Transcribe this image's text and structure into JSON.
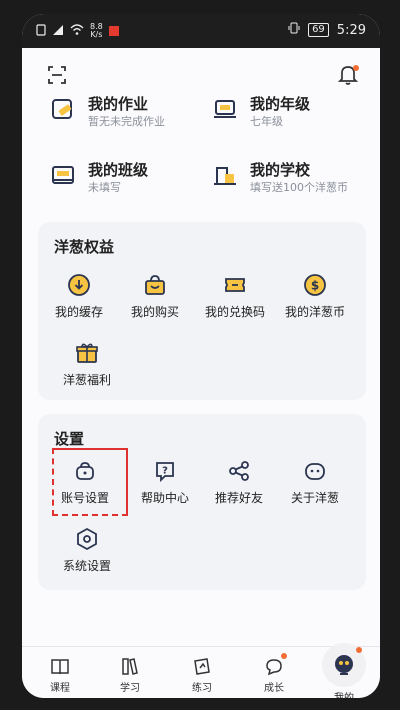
{
  "status_bar": {
    "net_speed_top": "8.8",
    "net_speed_unit": "K/s",
    "battery": "69",
    "time": "5:29"
  },
  "header": {
    "scan_icon": "scan-icon",
    "bell_icon": "bell-icon",
    "notification_dot_color": "#f06d34"
  },
  "profile": {
    "items": [
      {
        "title": "我的作业",
        "subtitle": "暂无未完成作业",
        "icon": "homework-icon"
      },
      {
        "title": "我的年级",
        "subtitle": "七年级",
        "icon": "grade-icon"
      },
      {
        "title": "我的班级",
        "subtitle": "未填写",
        "icon": "class-icon"
      },
      {
        "title": "我的学校",
        "subtitle": "填写送100个洋葱币",
        "icon": "school-icon"
      }
    ]
  },
  "benefits": {
    "title": "洋葱权益",
    "items": [
      {
        "label": "我的缓存",
        "icon": "download-icon"
      },
      {
        "label": "我的购买",
        "icon": "shopping-bag-icon"
      },
      {
        "label": "我的兑换码",
        "icon": "ticket-icon"
      },
      {
        "label": "我的洋葱币",
        "icon": "coin-icon"
      },
      {
        "label": "洋葱福利",
        "icon": "gift-icon"
      }
    ]
  },
  "settings": {
    "title": "设置",
    "items": [
      {
        "label": "账号设置",
        "icon": "account-lock-icon"
      },
      {
        "label": "帮助中心",
        "icon": "help-icon"
      },
      {
        "label": "推荐好友",
        "icon": "share-icon"
      },
      {
        "label": "关于洋葱",
        "icon": "onion-face-icon"
      },
      {
        "label": "系统设置",
        "icon": "settings-hex-icon"
      }
    ]
  },
  "tabbar": {
    "tabs": [
      {
        "label": "课程",
        "icon": "book-icon"
      },
      {
        "label": "学习",
        "icon": "books-icon"
      },
      {
        "label": "练习",
        "icon": "practice-icon"
      },
      {
        "label": "成长",
        "icon": "growth-icon"
      },
      {
        "label": "我的",
        "icon": "profile-avatar-icon"
      }
    ]
  },
  "colors": {
    "accent_yellow": "#f6c343",
    "accent_navy": "#2b3550",
    "highlight_red": "#e03131"
  }
}
